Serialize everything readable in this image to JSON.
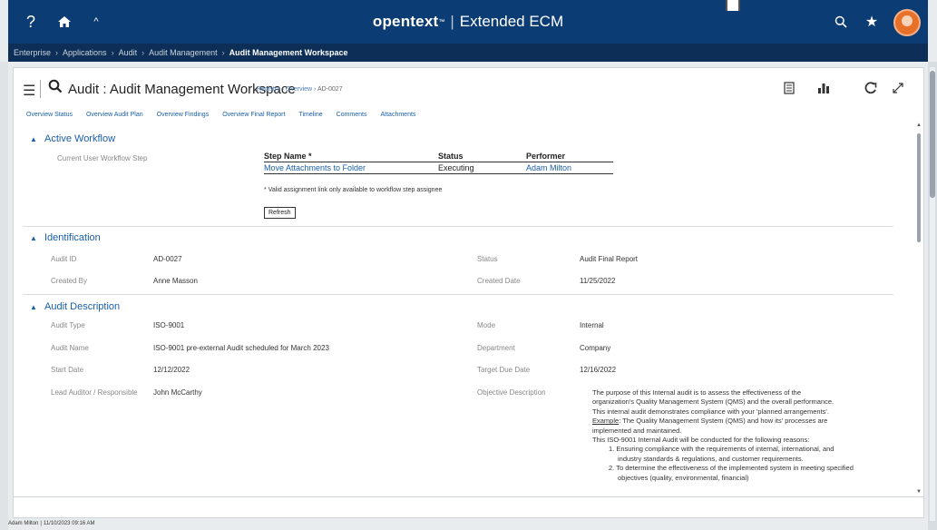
{
  "topbar": {
    "help_glyph": "?",
    "home_glyph": "⌂",
    "collapse_glyph": "^",
    "brand_name": "opentext",
    "brand_tm": "™",
    "brand_product": "Extended ECM",
    "search_glyph": "⌕",
    "favorites_glyph": "★"
  },
  "breadcrumbs": [
    "Enterprise",
    "Applications",
    "Audit",
    "Audit Management",
    "Audit Management Workspace"
  ],
  "workspace": {
    "title": "Audit : Audit Management Workspace",
    "registry_path": [
      "Registry",
      "Overview",
      "AD-0027"
    ]
  },
  "tabs": [
    "Overview Status",
    "Overview Audit Plan",
    "Overview Findings",
    "Overview Final Report",
    "Timeline",
    "Comments",
    "Attachments"
  ],
  "active_workflow": {
    "title": "Active Workflow",
    "current_step_label": "Current User Workflow Step",
    "col_step": "Step Name *",
    "col_status": "Status",
    "col_performer": "Performer",
    "step_name": "Move Attachments to Folder",
    "step_status": "Executing",
    "performer": "Adam Milton",
    "note": "* Valid assignment link only available to workflow step assignee",
    "refresh_label": "Refresh"
  },
  "identification": {
    "title": "Identification",
    "audit_id_label": "Audit ID",
    "audit_id": "AD-0027",
    "status_label": "Status",
    "status": "Audit Final Report",
    "created_by_label": "Created By",
    "created_by": "Anne Masson",
    "created_date_label": "Created Date",
    "created_date": "11/25/2022"
  },
  "audit_description": {
    "title": "Audit Description",
    "audit_type_label": "Audit Type",
    "audit_type": "ISO-9001",
    "mode_label": "Mode",
    "mode": "Internal",
    "audit_name_label": "Audit Name",
    "audit_name": "ISO-9001 pre-external Audit scheduled for March 2023",
    "department_label": "Department",
    "department": "Company",
    "start_date_label": "Start Date",
    "start_date": "12/12/2022",
    "target_due_label": "Target Due Date",
    "target_due": "12/16/2022",
    "lead_label": "Lead Auditor / Responsible",
    "lead": "John McCarthy",
    "objective_label": "Objective Description",
    "objective_lines": [
      "The purpose of this Internal audit is to assess the effectiveness of the",
      "organization's Quality Management System (QMS) and the overall performance.",
      "This internal audit demonstrates compliance with your 'planned arrangements'.",
      "The Quality Management System (QMS) and how its' processes are",
      "implemented and maintained.",
      "This ISO-9001 Internal Audit will be conducted for the following reasons:",
      "1. Ensuring compliance with the requirements of internal, international, and",
      "industry standards & regulations, and customer requirements.",
      "2. To determine the effectiveness of the implemented system in meeting specified",
      "objectives (quality, environmental, financial)"
    ],
    "example_label": "Example"
  },
  "status_bar": {
    "user": "Adam Milton",
    "timestamp": "11/10/2023 09:16 AM"
  },
  "colors": {
    "topbar": "#0b3c73",
    "crumbbar": "#0d2f57",
    "link": "#1a5fa8"
  }
}
